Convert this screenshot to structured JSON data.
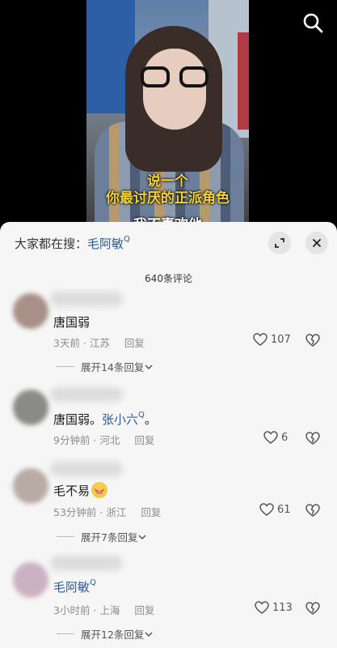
{
  "video": {
    "subtitle_line1": "说一个",
    "subtitle_line2": "你最讨厌的正派角色",
    "subtitle_line3": "我不喜欢他"
  },
  "sheet": {
    "search_prefix": "大家都在搜：",
    "search_keyword": "毛阿敏",
    "comment_count": "640条评论"
  },
  "comments": [
    {
      "text": "唐国弱",
      "time": "3天前",
      "location": "江苏",
      "reply_label": "回复",
      "likes": "107",
      "expand_label": "展开14条回复"
    },
    {
      "text": "唐国弱。",
      "mention": "张小六",
      "text_suffix": "。",
      "time": "9分钟前",
      "location": "河北",
      "reply_label": "回复",
      "likes": "6"
    },
    {
      "text": "毛不易",
      "emoji": "laughing-emoji",
      "time": "53分钟前",
      "location": "浙江",
      "reply_label": "回复",
      "likes": "61",
      "expand_label": "展开7条回复"
    },
    {
      "mention": "毛阿敏",
      "time": "3小时前",
      "location": "上海",
      "reply_label": "回复",
      "likes": "113",
      "expand_label": "展开12条回复"
    }
  ],
  "colors": {
    "link": "#2e5a9c",
    "subtitle": "#f2d23a",
    "sheet_bg": "#f6f6f6"
  }
}
